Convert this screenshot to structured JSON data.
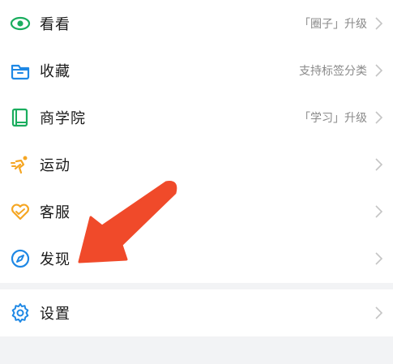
{
  "menu": [
    {
      "key": "kankan",
      "label": "看看",
      "desc": "「圈子」升级"
    },
    {
      "key": "favorites",
      "label": "收藏",
      "desc": "支持标签分类"
    },
    {
      "key": "business-school",
      "label": "商学院",
      "desc": "「学习」升级"
    },
    {
      "key": "sports",
      "label": "运动",
      "desc": ""
    },
    {
      "key": "customer-service",
      "label": "客服",
      "desc": ""
    },
    {
      "key": "discover",
      "label": "发现",
      "desc": ""
    }
  ],
  "settings": {
    "label": "设置"
  },
  "colors": {
    "green": "#1aad5e",
    "blue": "#1e88e5",
    "orange": "#f5a623",
    "arrow_red": "#f04a2a"
  },
  "icons": [
    "eye-icon",
    "folder-icon",
    "book-icon",
    "running-icon",
    "heart-icon",
    "compass-icon",
    "gear-icon",
    "chevron-right-icon"
  ]
}
